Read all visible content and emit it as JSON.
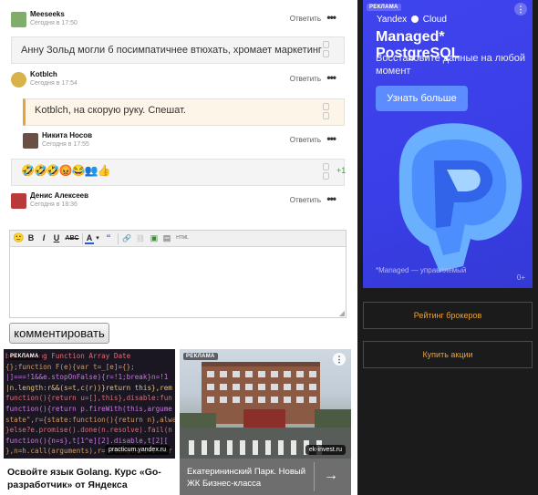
{
  "comments": [
    {
      "author": "Meeseeks",
      "date": "Сегодня в 17:50",
      "reply": "Ответить",
      "more": "•••",
      "avatar_color": "#7fae6a"
    },
    {
      "text": "Анну Зольд могли б посимпатичнее втюхать, хромает маркетинг",
      "author": "Kotblch",
      "date": "Сегодня в 17:54",
      "reply": "Ответить",
      "more": "•••",
      "avatar_color": "#d8b24a"
    },
    {
      "text": "Kotblch, на скорую руку. Спешат.",
      "author": "Никита Носов",
      "date": "Сегодня в 17:55",
      "reply": "Ответить",
      "more": "•••",
      "avatar_color": "#6b4f44",
      "highlight_color": "#e8a338"
    },
    {
      "emojis": "🤣🤣🤣😡😂👥👍",
      "score": "+1",
      "author": "Денис Алексеев",
      "date": "Сегодня в 18:36",
      "reply": "Ответить",
      "more": "•••",
      "avatar_color": "#b83a3a",
      "score_color": "#3aa33a"
    }
  ],
  "editor": {
    "toolbar": {
      "smile": "🙂",
      "bold": "B",
      "italic": "I",
      "underline": "U",
      "strike": "ABC",
      "font_color": "A",
      "font_color_arrow": "▾",
      "quote": "“",
      "link": "🔗",
      "unlink": "⛓",
      "image": "▣",
      "video": "▤",
      "html": "HTML"
    },
    "submit_label": "комментировать"
  },
  "ads": {
    "label": "РЕКЛАМА",
    "card1": {
      "title": "Освойте язык Golang. Курс «Go-разработчик» от Яндекса",
      "source": "practicum.yandex.ru",
      "code_lines": [
        "ber String Function Array Date",
        "{};function F(e){var t=_[e]={};",
        "|]===!1&&e.stopOnFalse){r=!1;break}n=!1",
        "|n.length:r&&(s=t,c(r))}return this},rem",
        "function(){return u=[],this},disable:fun",
        "function(){return p.fireWith(this,argume",
        "state\",r={state:function(){return n},alwa",
        "}else?e.promise().done(n.resolve).fail(n",
        "function(){n=s},t[1^e][2].disable,t[2][",
        "},n=h.call(arguments),r=n.length,i=1!==r",
        "(r),l=Array(r);r>t;t++)n[t]&&n[t].isFunc",
        "table></table><a href='/a'>a</a><input"
      ]
    },
    "card2": {
      "title": "Екатерининский Парк. Новый ЖК Бизнес-класса",
      "source": "ek-invest.ru",
      "arrow": "→",
      "menu": "⋮"
    },
    "yandex": {
      "brand": "Yandex",
      "brand2": "Cloud",
      "heading": "Managed* PostgreSQL",
      "subtitle": "Восстановите данные на любой момент",
      "button": "Узнать больше",
      "footnote": "*Managed — управляемый",
      "counter": "0+",
      "menu": "⋮"
    }
  },
  "sidebar_buttons": [
    "Рейтинг брокеров",
    "Купить акции"
  ],
  "colors": {
    "accent": "#e8a338",
    "sidebar_bg": "#1b1b1b",
    "ad_blue": "#3f44ee"
  }
}
